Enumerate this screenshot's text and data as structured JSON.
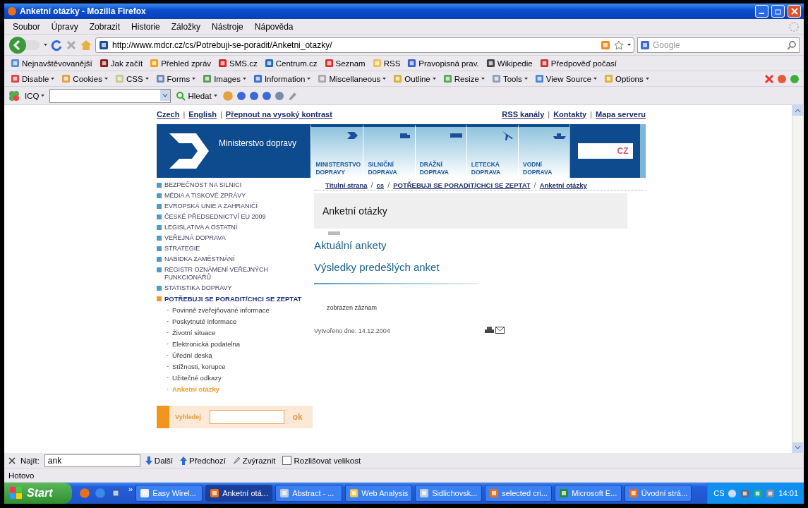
{
  "window": {
    "title": "Anketní otázky - Mozilla Firefox"
  },
  "menu": [
    "Soubor",
    "Úpravy",
    "Zobrazit",
    "Historie",
    "Záložky",
    "Nástroje",
    "Nápověda"
  ],
  "navigation": {
    "url": "http://www.mdcr.cz/cs/Potrebuji-se-poradit/Anketni_otazky/",
    "search_placeholder": "Google"
  },
  "bookmarks": [
    "Nejnavštěvovanější",
    "Jak začít",
    "Přehled zpráv",
    "SMS.cz",
    "Centrum.cz",
    "Seznam",
    "RSS",
    "Pravopisná prav.",
    "Wikipedie",
    "Předpověď počasí"
  ],
  "developer_toolbar": [
    "Disable",
    "Cookies",
    "CSS",
    "Forms",
    "Images",
    "Information",
    "Miscellaneous",
    "Outline",
    "Resize",
    "Tools",
    "View Source",
    "Options"
  ],
  "icq_toolbar": {
    "label": "ICQ",
    "search_button": "Hledat"
  },
  "page": {
    "language_links": {
      "separator": "|",
      "items": [
        "Czech",
        "English",
        "Přepnout na vysoký kontrast"
      ]
    },
    "top_links": {
      "separator": "|",
      "items": [
        "RSS kanály",
        "Kontakty",
        "Mapa serveru"
      ]
    },
    "banner": {
      "title": "Ministerstvo dopravy",
      "badge": "CZ",
      "tiles": [
        "MINISTERSTVO DOPRAVY",
        "SILNIČNÍ DOPRAVA",
        "DRÁŽNÍ DOPRAVA",
        "LETECKÁ DOPRAVA",
        "VODNÍ DOPRAVA"
      ]
    },
    "sidebar": [
      {
        "label": "BEZPEČNOST NA SILNICI",
        "selected": false
      },
      {
        "label": "MÉDIA A TISKOVÉ ZPRÁVY",
        "selected": false
      },
      {
        "label": "EVROPSKÁ UNIE A ZAHRANIČÍ",
        "selected": false
      },
      {
        "label": "ČESKÉ PŘEDSEDNICTVÍ EU 2009",
        "selected": false
      },
      {
        "label": "LEGISLATIVA A OSTATNÍ",
        "selected": false
      },
      {
        "label": "VEŘEJNÁ DOPRAVA",
        "selected": false
      },
      {
        "label": "STRATEGIE",
        "selected": false
      },
      {
        "label": "NABÍDKA ZAMĚSTNÁNÍ",
        "selected": false
      },
      {
        "label": "REGISTR OZNÁMENÍ VEŘEJNÝCH FUNKCIONÁŘŮ",
        "selected": false
      },
      {
        "label": "STATISTIKA DOPRAVY",
        "selected": false
      },
      {
        "label": "POTŘEBUJI SE PORADIT/CHCI SE ZEPTAT",
        "selected": true,
        "children": [
          {
            "label": "Povinně zveřejňované informace",
            "selected": false
          },
          {
            "label": "Poskytnuté informace",
            "selected": false
          },
          {
            "label": "Životní situace",
            "selected": false
          },
          {
            "label": "Elektronická podatelna",
            "selected": false
          },
          {
            "label": "Úřední deska",
            "selected": false
          },
          {
            "label": "Stížnosti, korupce",
            "selected": false
          },
          {
            "label": "Užitečné odkazy",
            "selected": false
          },
          {
            "label": "Anketní otázky",
            "selected": true
          }
        ]
      }
    ],
    "child_marker": "-",
    "search": {
      "label": "Vyhledej",
      "button": "ok"
    },
    "breadcrumb": {
      "separator": "/",
      "items": [
        "Titulní strana",
        "cs",
        "POTŘEBUJI SE PORADIT/CHCI SE ZEPTAT",
        "Anketní otázky"
      ]
    },
    "heading": "Anketní otázky",
    "links": [
      "Aktuální ankety",
      "Výsledky predešlých anket"
    ],
    "record_note": "zobrazen záznam",
    "created": "Vytvořeno dne: 14.12.2004"
  },
  "find_bar": {
    "label": "Najít:",
    "value": "ank",
    "next": "Další",
    "previous": "Předchozí",
    "highlight": "Zvýraznit",
    "match_case": {
      "label": "Rozlišovat velikost",
      "checked": false
    }
  },
  "status_bar": "Hotovo",
  "taskbar": {
    "start": "Start",
    "more": "»",
    "tasks": [
      {
        "label": "Easy Wirel...",
        "selected": false
      },
      {
        "label": "Anketní otá...",
        "selected": true
      },
      {
        "label": "Abstract - ...",
        "selected": false
      },
      {
        "label": "Web Analysis",
        "selected": false
      },
      {
        "label": "Sidlichovsk...",
        "selected": false
      },
      {
        "label": "selected cri...",
        "selected": false
      },
      {
        "label": "Microsoft E...",
        "selected": false
      },
      {
        "label": "Úvodní strá...",
        "selected": false
      }
    ],
    "language": "CS",
    "time": "14:01"
  }
}
